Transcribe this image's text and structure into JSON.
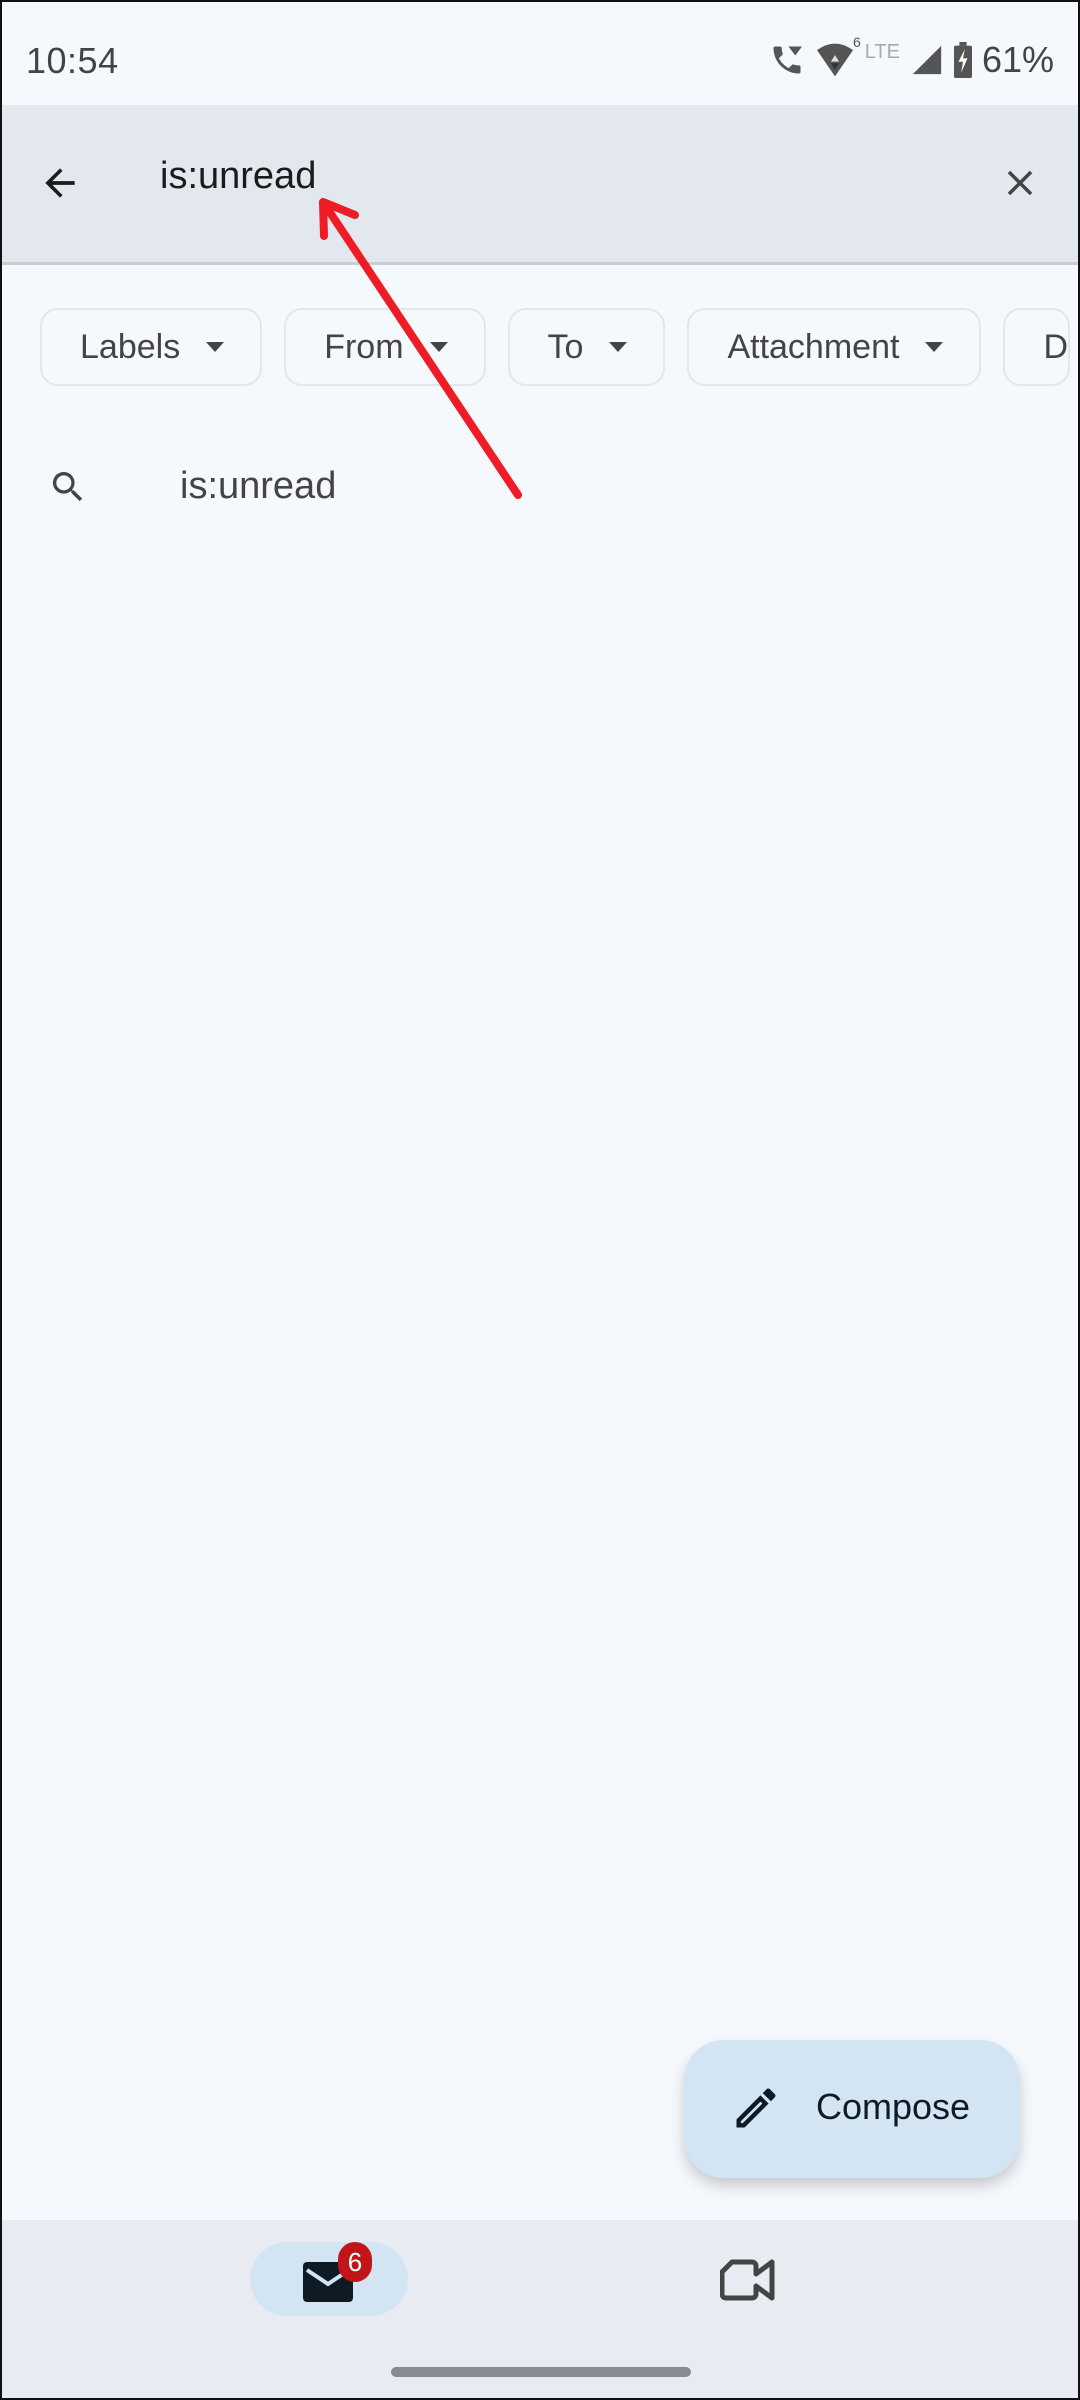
{
  "status_bar": {
    "time": "10:54",
    "network_label": "LTE",
    "wifi_badge": "6",
    "battery_percent": "61%",
    "icons": [
      "wifi-calling-icon",
      "wifi-icon",
      "signal-icon",
      "battery-charging-icon"
    ]
  },
  "search_header": {
    "back_icon": "arrow-left-icon",
    "query": "is:unread",
    "clear_icon": "close-icon"
  },
  "filter_chips": [
    {
      "label": "Labels"
    },
    {
      "label": "From"
    },
    {
      "label": "To"
    },
    {
      "label": "Attachment"
    },
    {
      "label": "D"
    }
  ],
  "suggestions": [
    {
      "icon": "search-icon",
      "text": "is:unread"
    }
  ],
  "compose_button": {
    "icon": "pencil-icon",
    "label": "Compose"
  },
  "bottom_nav": {
    "items": [
      {
        "name": "mail",
        "icon": "mail-icon",
        "badge": "6",
        "selected": true
      },
      {
        "name": "meet",
        "icon": "video-camera-icon",
        "selected": false
      }
    ]
  },
  "annotation": {
    "type": "arrow",
    "color": "#ee1c24",
    "points_to": "search-query"
  }
}
